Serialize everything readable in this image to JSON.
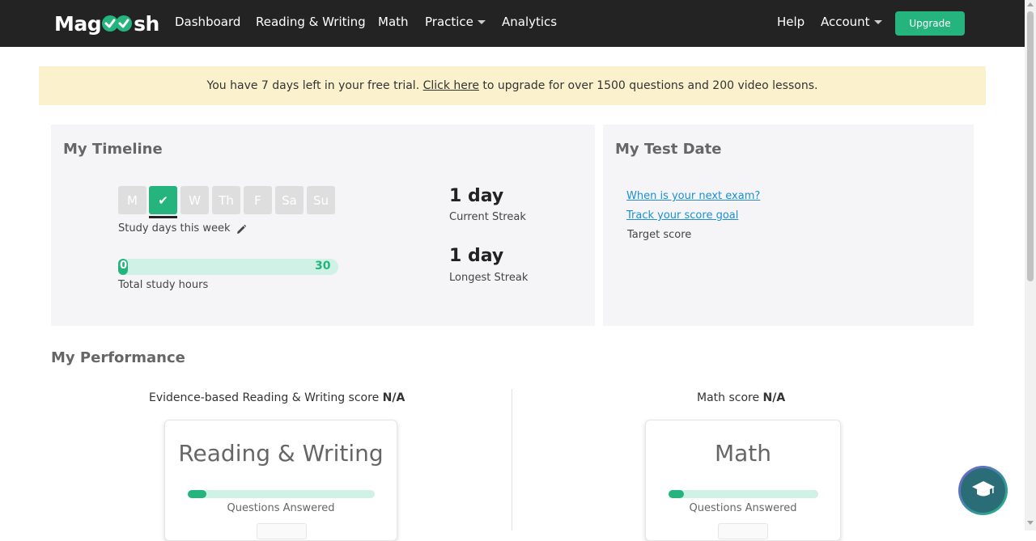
{
  "brand": {
    "logo_left": "Mag",
    "logo_right": "sh",
    "accent_color": "#25b47e"
  },
  "nav": {
    "items": [
      {
        "label": "Dashboard"
      },
      {
        "label": "Reading & Writing"
      },
      {
        "label": "Math"
      },
      {
        "label": "Practice",
        "dropdown": true
      },
      {
        "label": "Analytics"
      }
    ],
    "right_items": [
      {
        "label": "Help"
      },
      {
        "label": "Account",
        "dropdown": true
      }
    ],
    "upgrade_label": "Upgrade"
  },
  "banner": {
    "text_before": "You have 7 days left in your free trial. ",
    "link_text": "Click here",
    "text_after": " to upgrade for over 1500 questions and 200 video lessons."
  },
  "timeline": {
    "title": "My Timeline",
    "days": [
      {
        "label": "M",
        "completed": false
      },
      {
        "label": "✔",
        "completed": true
      },
      {
        "label": "W",
        "completed": false
      },
      {
        "label": "Th",
        "completed": false
      },
      {
        "label": "F",
        "completed": false
      },
      {
        "label": "Sa",
        "completed": false
      },
      {
        "label": "Su",
        "completed": false
      }
    ],
    "study_days_label": "Study days this week",
    "hours": {
      "current": "0",
      "max": "30",
      "progress_fraction": 0.04
    },
    "total_hours_label": "Total study hours",
    "current_streak": {
      "value": "1 day",
      "label": "Current Streak"
    },
    "longest_streak": {
      "value": "1 day",
      "label": "Longest Streak"
    }
  },
  "test_date": {
    "title": "My Test Date",
    "next_exam_link": "When is your next exam?",
    "score_goal_link": "Track your score goal",
    "target_score_label": "Target score"
  },
  "performance": {
    "title": "My Performance",
    "rw_score_label": "Evidence-based Reading & Writing score",
    "rw_score_value": "N/A",
    "math_score_label": "Math score",
    "math_score_value": "N/A",
    "rw_card": {
      "title": "Reading & Writing",
      "label": "Questions Answered",
      "progress_fraction": 0.1
    },
    "math_card": {
      "title": "Math",
      "label": "Questions Answered",
      "progress_fraction": 0.1
    }
  },
  "help_fab": {
    "icon": "graduation-cap-icon"
  }
}
